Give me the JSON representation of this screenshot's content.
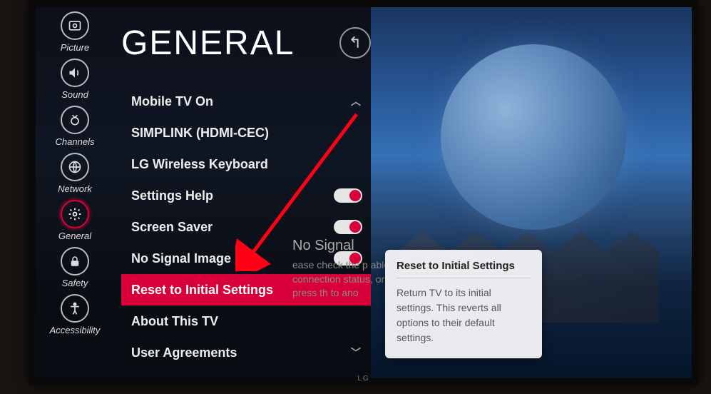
{
  "header": {
    "title": "GENERAL"
  },
  "sidebar": {
    "items": [
      {
        "label": "Picture"
      },
      {
        "label": "Sound"
      },
      {
        "label": "Channels"
      },
      {
        "label": "Network"
      },
      {
        "label": "General"
      },
      {
        "label": "Safety"
      },
      {
        "label": "Accessibility"
      }
    ]
  },
  "settings": {
    "items": [
      {
        "label": "Mobile TV On"
      },
      {
        "label": "SIMPLINK (HDMI-CEC)"
      },
      {
        "label": "LG Wireless Keyboard"
      },
      {
        "label": "Settings Help"
      },
      {
        "label": "Screen Saver"
      },
      {
        "label": "No Signal Image"
      },
      {
        "label": "Reset to Initial Settings"
      },
      {
        "label": "About This TV"
      },
      {
        "label": "User Agreements"
      }
    ]
  },
  "nosignal": {
    "title": "No Signal",
    "body": "ease check the p\nable connection status, or press th\nto ano"
  },
  "tooltip": {
    "title": "Reset to Initial Settings",
    "body": "Return TV to its initial settings. This reverts all options to their default settings."
  },
  "brand": "LG"
}
